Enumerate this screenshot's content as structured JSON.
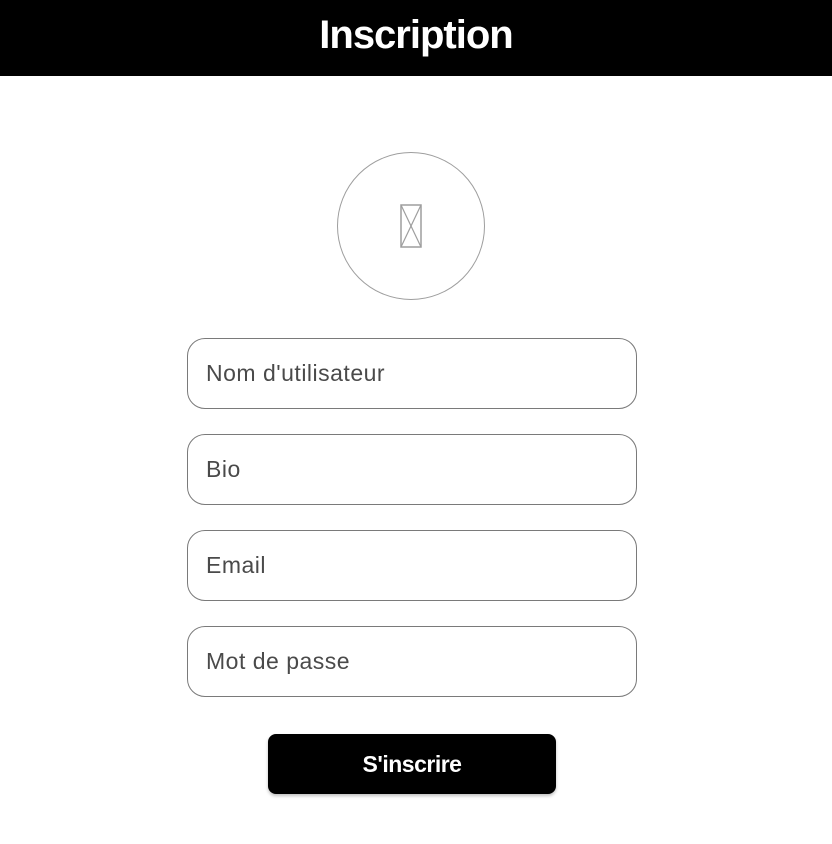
{
  "header": {
    "title": "Inscription",
    "background_color": "#000000",
    "text_color": "#ffffff"
  },
  "avatar": {
    "icon": "broken-image-icon"
  },
  "form": {
    "fields": [
      {
        "name": "username",
        "placeholder": "Nom d'utilisateur",
        "value": ""
      },
      {
        "name": "bio",
        "placeholder": "Bio",
        "value": ""
      },
      {
        "name": "email",
        "placeholder": "Email",
        "value": ""
      },
      {
        "name": "password",
        "placeholder": "Mot de passe",
        "value": ""
      }
    ],
    "submit_label": "S'inscrire"
  }
}
